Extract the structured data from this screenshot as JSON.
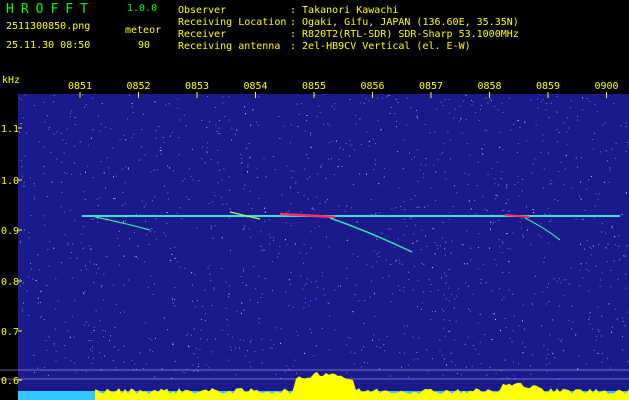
{
  "header": {
    "brand": "HROFFT",
    "version": "1.0.0",
    "filename": "2511300850.png",
    "mode": "meteor",
    "timestamp": "25.11.30 08:50",
    "count": "90",
    "info": [
      {
        "label": "Observer",
        "value": ": Takanori Kawachi"
      },
      {
        "label": "Receiving Location",
        "value": ": Ogaki, Gifu, JAPAN (136.60E, 35.35N)"
      },
      {
        "label": "Receiver",
        "value": ": R820T2(RTL-SDR) SDR-Sharp 53.1000MHz"
      },
      {
        "label": "Receiving antenna",
        "value": ": 2el-HB9CV Vertical (el. E-W)"
      }
    ]
  },
  "spectrogram": {
    "freq_unit": "kHz",
    "freq_ticks": [
      "1.1",
      "1.0",
      "0.9",
      "0.8",
      "0.7",
      "0.6"
    ],
    "time_ticks": [
      "0851",
      "0852",
      "0853",
      "0854",
      "0855",
      "0856",
      "0857",
      "0858",
      "0859",
      "0900"
    ],
    "colors": {
      "background": "#1a1a8c",
      "noise": "#5a8cff",
      "carrier": "#40e0d0",
      "strong": "#ff3060",
      "axis_text": "#ffff00",
      "profile": "#ffff00",
      "profile_low": "#30c8ff"
    }
  }
}
